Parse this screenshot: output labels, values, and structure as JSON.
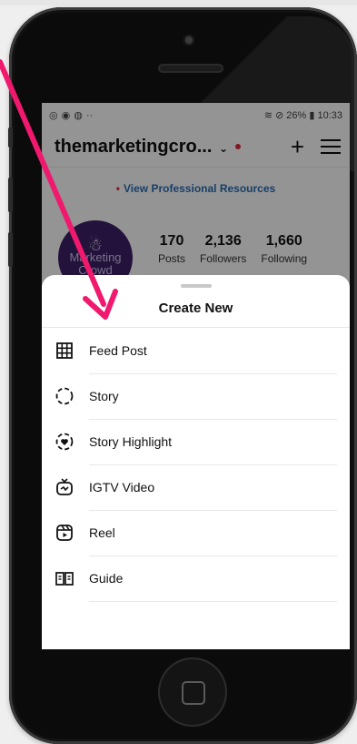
{
  "status_bar": {
    "left_icons": [
      "◎",
      "◉",
      "◍",
      "··"
    ],
    "battery": "26%",
    "time": "10:33"
  },
  "header": {
    "username": "themarketingcro...",
    "chevron": "⌄",
    "plus": "+"
  },
  "pro_resources": {
    "label": "View Professional Resources"
  },
  "profile": {
    "avatar_text": [
      "Marketing",
      "Crowd"
    ],
    "stats": [
      {
        "value": "170",
        "label": "Posts"
      },
      {
        "value": "2,136",
        "label": "Followers"
      },
      {
        "value": "1,660",
        "label": "Following"
      }
    ]
  },
  "sheet": {
    "title": "Create New",
    "items": [
      {
        "label": "Feed Post",
        "icon": "grid-icon"
      },
      {
        "label": "Story",
        "icon": "story-icon"
      },
      {
        "label": "Story Highlight",
        "icon": "highlight-icon"
      },
      {
        "label": "IGTV Video",
        "icon": "igtv-icon"
      },
      {
        "label": "Reel",
        "icon": "reel-icon"
      },
      {
        "label": "Guide",
        "icon": "guide-icon"
      }
    ]
  },
  "colors": {
    "arrow": "#f0196e",
    "link": "#2a6db5",
    "dot": "#e0283c"
  }
}
